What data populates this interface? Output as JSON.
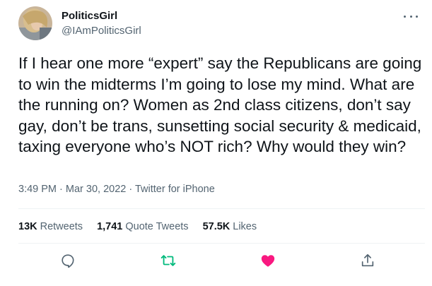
{
  "author": {
    "display_name": "PoliticsGirl",
    "handle": "@IAmPoliticsGirl"
  },
  "tweet": {
    "text": "If I hear one more “expert” say the Republicans are going to win the midterms I’m going to lose my mind. What are the running on? Women as 2nd class citizens, don’t say gay, don’t be trans, sunsetting social security & medicaid, taxing everyone who’s NOT rich? Why would they win?",
    "time": "3:49 PM",
    "separator": " · ",
    "date": "Mar 30, 2022",
    "source": "Twitter for iPhone"
  },
  "stats": {
    "retweets_count": "13K",
    "retweets_label": "Retweets",
    "quotes_count": "1,741",
    "quotes_label": "Quote Tweets",
    "likes_count": "57.5K",
    "likes_label": "Likes"
  },
  "icons": {
    "more": "more-dots-icon",
    "reply": "reply-icon",
    "retweet": "retweet-icon",
    "like": "heart-icon",
    "share": "share-icon"
  },
  "colors": {
    "retweet": "#00ba7c",
    "like": "#f91880",
    "secondary_text": "#536471"
  }
}
